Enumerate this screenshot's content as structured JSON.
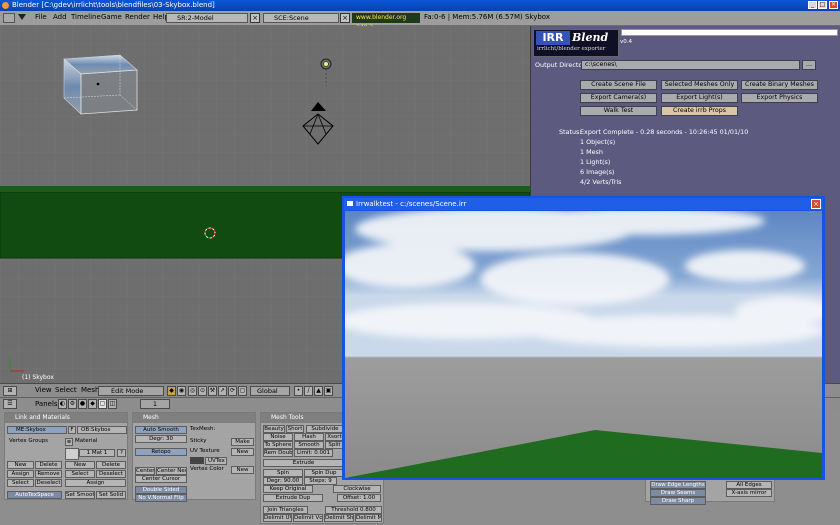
{
  "window": {
    "title": "Blender [C:\\gdev\\irrlicht\\tools\\blendfiles\\03-Skybox.blend]"
  },
  "menubar": {
    "items": [
      "File",
      "Add",
      "Timeline",
      "Game",
      "Render",
      "Help"
    ],
    "screen": "SR:2-Model",
    "scene": "SCE:Scene",
    "link": "www.blender.org 249.2",
    "stats": "Fa:0-6 | Mem:5.76M (6.57M) Skybox"
  },
  "viewport": {
    "object_label": "(1) Skybox"
  },
  "irrblend": {
    "logo_main": "IRR",
    "logo_script": "Blend",
    "logo_sub": "irrlicht/blender exporter",
    "version": "v0.4",
    "output_label": "Output Directory",
    "output_value": "c:\\scenes\\",
    "browse": "...",
    "buttons": {
      "create_scene": "Create Scene File",
      "selected_meshes": "Selected Meshes Only",
      "create_binary": "Create Binary Meshes",
      "export_cameras": "Export Camera(s)",
      "export_lights": "Export Light(s)",
      "export_physics": "Export Physics",
      "walk_test": "Walk Test",
      "create_props": "Create irrb Props"
    },
    "status_label": "Status:",
    "status_lines": [
      "Export Complete - 0.28 seconds - 10:26:45 01/01/10",
      "1 Object(s)",
      "1 Mesh",
      "1 Light(s)",
      "6 Image(s)",
      "4/2 Verts/Tris"
    ]
  },
  "header3d": {
    "view": "View",
    "select": "Select",
    "mesh": "Mesh",
    "mode": "Edit Mode",
    "orientation": "Global"
  },
  "buttons_header": {
    "panels": "Panels",
    "frame": "1"
  },
  "link_materials": {
    "title": "Link and Materials",
    "me": "ME:Skybox",
    "f": "F",
    "ob": "OB:Skybox",
    "vertex_groups": "Vertex Groups",
    "material": "Material",
    "mat_count": "1 Mat 1",
    "q": "?",
    "new": "New",
    "delete": "Delete",
    "assign": "Assign",
    "remove": "Remove",
    "select": "Select",
    "deselect": "Deselect",
    "autotexspace": "AutoTexSpace",
    "set_smooth": "Set Smooth",
    "set_solid": "Set Solid"
  },
  "mesh_panel": {
    "title": "Mesh",
    "auto_smooth": "Auto Smooth",
    "degr": "Degr: 30",
    "retopo": "Retopo",
    "texmesh": "TexMesh:",
    "sticky": "Sticky",
    "make": "Make",
    "uv_texture": "UV Texture",
    "new": "New",
    "uvtex": "UVTex",
    "vertex_color": "Vertex Color",
    "center": "Center",
    "center_new": "Center New",
    "center_cursor": "Center Cursor",
    "double_sided": "Double Sided",
    "no_v_normal_flip": "No V.Normal Flip"
  },
  "mesh_tools": {
    "title": "Mesh Tools",
    "beauty": "Beauty",
    "short": "Short",
    "subdivide": "Subdivide",
    "noise": "Noise",
    "hash": "Hash",
    "xsort": "Xsort",
    "to_sphere": "To Sphere",
    "smooth": "Smooth",
    "split": "Split",
    "rem_double": "Rem Double",
    "limit": "Limit: 0.001",
    "extrude": "Extrude",
    "spin": "Spin",
    "spin_dup": "Spin Dup",
    "degr": "Degr: 90.00",
    "steps": "Steps: 9",
    "keep_original": "Keep Original",
    "clockwise": "Clockwise",
    "extrude_dup": "Extrude Dup",
    "offset": "Offset: 1.00",
    "join_triangles": "Join Triangles",
    "threshold": "Threshold 0.800",
    "delimit_uvs": "Delimit UVs",
    "delimit_vcol": "Delimit Vcol",
    "delimit_sharp": "Delimit Shar",
    "delimit_mat": "Delimit Mat"
  },
  "mesh_tools_more": {
    "draw_edge_lengths": "Draw Edge Lengths",
    "draw_seams": "Draw Seams",
    "draw_sharp": "Draw Sharp",
    "all_edges": "All Edges",
    "x_axis_mirror": "X-axis mirror"
  },
  "irr_window": {
    "title": "Irrwalktest - c:/scenes/Scene.irr"
  },
  "colors": {
    "title_blue": "#0a57d8",
    "irr_panel": "#5d5a80",
    "viewport_grey": "#6e6e6e",
    "floor_green": "#145214",
    "irr_floor_green": "#1f6b1f"
  }
}
